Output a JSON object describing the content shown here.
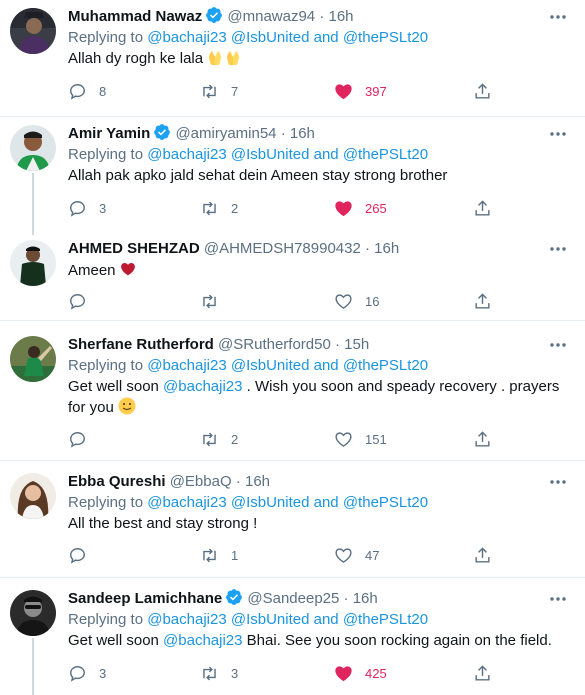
{
  "replying_prefix": "Replying to",
  "reply_mentions": [
    "@bachaji23",
    "@IsbUnited",
    "and",
    "@thePSLt20"
  ],
  "tweets": [
    {
      "name": "Muhammad Nawaz",
      "handle": "@mnawaz94",
      "time": "16h",
      "verified": true,
      "body": "Allah dy rogh ke lala",
      "body_emoji": "folded-hands-emoji x2",
      "replies": "8",
      "retweets": "7",
      "likes": "397",
      "liked": true
    },
    {
      "name": "Amir Yamin",
      "handle": "@amiryamin54",
      "time": "16h",
      "verified": true,
      "body": "Allah pak apko jald sehat dein Ameen stay strong brother",
      "replies": "3",
      "retweets": "2",
      "likes": "265",
      "liked": true
    },
    {
      "name": "AHMED SHEHZAD",
      "handle": "@AHMEDSH78990432",
      "time": "16h",
      "verified": false,
      "body": "Ameen",
      "body_emoji": "red-heart-emoji",
      "replies": "",
      "retweets": "",
      "likes": "16",
      "liked": false
    },
    {
      "name": "Sherfane Rutherford",
      "handle": "@SRutherford50",
      "time": "15h",
      "verified": false,
      "body_parts": [
        "Get well soon ",
        "@bachaji23",
        " . Wish you soon and speady recovery . prayers for you"
      ],
      "body_emoji": "slightly-smiling-face-emoji",
      "replies": "",
      "retweets": "2",
      "likes": "151",
      "liked": false
    },
    {
      "name": "Ebba Qureshi",
      "handle": "@EbbaQ",
      "time": "16h",
      "verified": false,
      "body": "All the best and stay strong !",
      "replies": "",
      "retweets": "1",
      "likes": "47",
      "liked": false
    },
    {
      "name": "Sandeep Lamichhane",
      "handle": "@Sandeep25",
      "time": "16h",
      "verified": true,
      "body_parts": [
        "Get well soon ",
        "@bachaji23",
        " Bhai. See you soon rocking again on the field."
      ],
      "replies": "3",
      "retweets": "3",
      "likes": "425",
      "liked": true
    }
  ],
  "colors": {
    "accent": "#1b95e0",
    "like": "#e0245e",
    "muted": "#5b7083",
    "divider": "#e6ecf0",
    "verified": "#1da1f2"
  }
}
